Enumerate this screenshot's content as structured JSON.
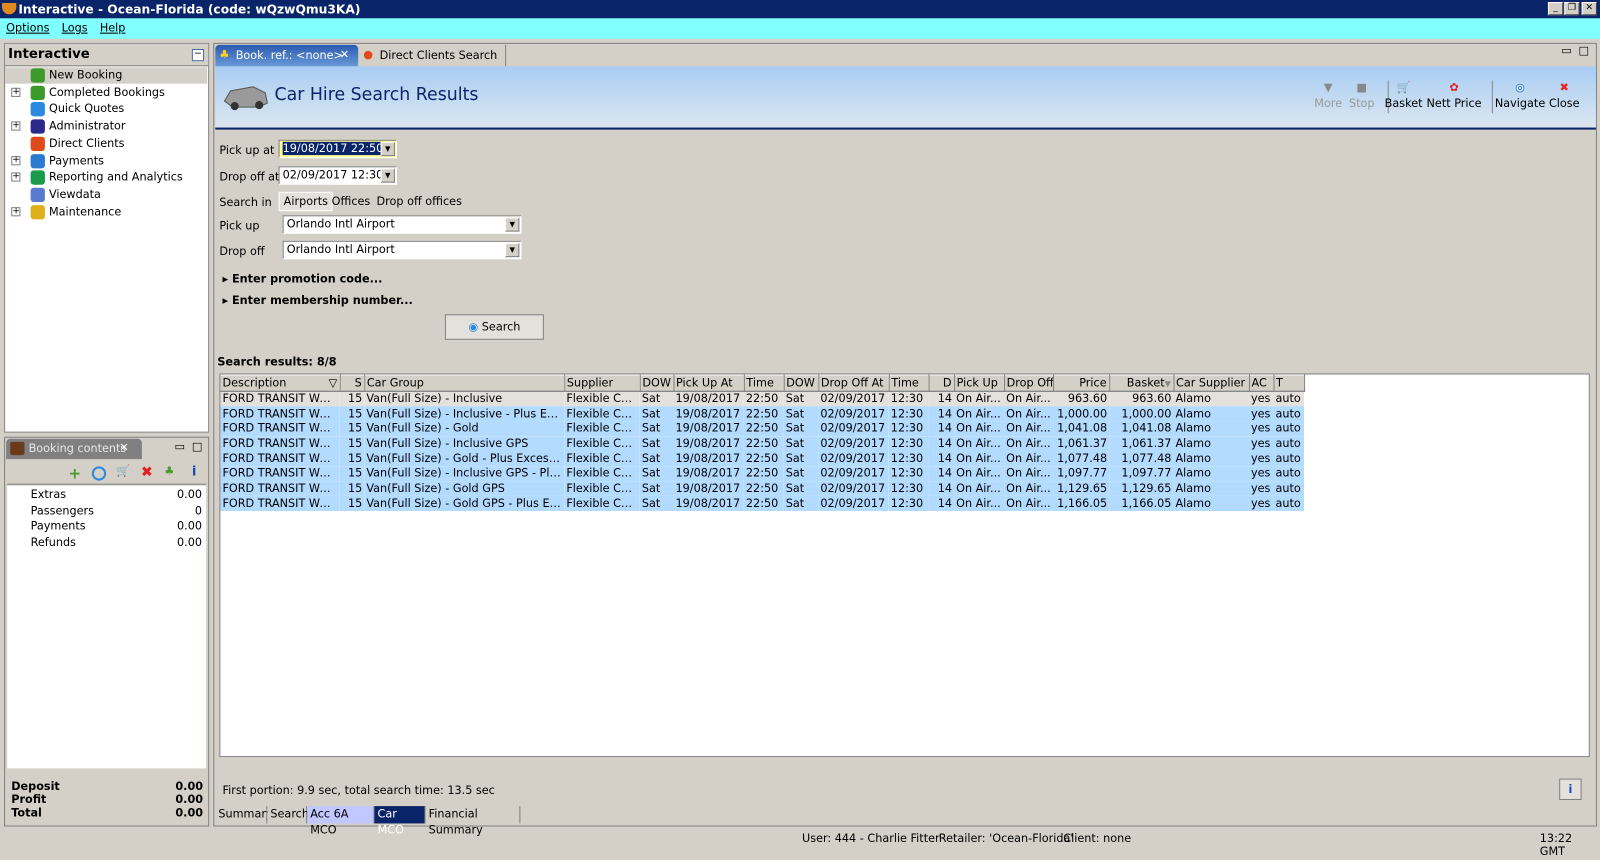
{
  "window": {
    "title": "Interactive - Ocean-Florida (code: wQzwQmu3KA)"
  },
  "menu": [
    "Options",
    "Logs",
    "Help"
  ],
  "sidebar": {
    "title": "Interactive",
    "items": [
      {
        "label": "New Booking",
        "expandable": false,
        "icon": "palm-tree-icon",
        "color": "#3a9a2a"
      },
      {
        "label": "Completed Bookings",
        "expandable": true,
        "icon": "palm-money-icon",
        "color": "#3a9a2a"
      },
      {
        "label": "Quick Quotes",
        "expandable": false,
        "icon": "clock-icon",
        "color": "#2a8ae0"
      },
      {
        "label": "Administrator",
        "expandable": true,
        "icon": "running-man-icon",
        "color": "#2a2a8a"
      },
      {
        "label": "Direct Clients",
        "expandable": false,
        "icon": "person-icon",
        "color": "#e04a1a"
      },
      {
        "label": "Payments",
        "expandable": true,
        "icon": "card-dollar-icon",
        "color": "#2a7ad0"
      },
      {
        "label": "Reporting and Analytics",
        "expandable": true,
        "icon": "report-icon",
        "color": "#1a9a4a"
      },
      {
        "label": "Viewdata",
        "expandable": false,
        "icon": "globe-icon",
        "color": "#5a7ad0"
      },
      {
        "label": "Maintenance",
        "expandable": true,
        "icon": "toolbox-icon",
        "color": "#e0b01a"
      }
    ]
  },
  "booking_contents": {
    "title": "Booking contents",
    "rows": [
      {
        "label": "Extras",
        "value": "0.00"
      },
      {
        "label": "Passengers",
        "value": "0"
      },
      {
        "label": "Payments",
        "value": "0.00"
      },
      {
        "label": "Refunds",
        "value": "0.00"
      }
    ],
    "totals": [
      {
        "label": "Deposit",
        "value": "0.00"
      },
      {
        "label": "Profit",
        "value": "0.00"
      },
      {
        "label": "Total",
        "value": "0.00"
      }
    ]
  },
  "tabs": [
    {
      "label": "Book. ref.: <none>",
      "active": true
    },
    {
      "label": "Direct Clients Search",
      "active": false
    }
  ],
  "header": {
    "title": "Car Hire Search Results"
  },
  "toolbar": [
    {
      "label": "More",
      "disabled": true,
      "icon": "more-arrow-icon"
    },
    {
      "label": "Stop",
      "disabled": true,
      "icon": "stop-icon"
    },
    {
      "label": "Basket",
      "disabled": false,
      "icon": "basket-icon"
    },
    {
      "label": "Nett Price",
      "disabled": false,
      "icon": "nett-price-icon"
    },
    {
      "label": "Navigate",
      "disabled": false,
      "icon": "compass-icon"
    },
    {
      "label": "Close",
      "disabled": false,
      "icon": "close-icon"
    }
  ],
  "form": {
    "pickup_at_label": "Pick up at",
    "pickup_at": "19/08/2017 22:50",
    "dropoff_at_label": "Drop off at",
    "dropoff_at": "02/09/2017 12:30",
    "search_in_label": "Search in",
    "search_in_options": [
      "Airports",
      "Offices",
      "Drop off offices"
    ],
    "search_in_selected": "Airports",
    "pickup_label": "Pick up",
    "pickup": "Orlando Intl Airport",
    "dropoff_label": "Drop off",
    "dropoff": "Orlando Intl Airport",
    "promo": "Enter promotion code...",
    "membership": "Enter membership number...",
    "search_button": "Search"
  },
  "results": {
    "summary": "Search results: 8/8",
    "columns": [
      "Description",
      "S",
      "Car Group",
      "Supplier",
      "DOW",
      "Pick Up At",
      "Time",
      "DOW",
      "Drop Off At",
      "Time",
      "D",
      "Pick Up",
      "Drop Off",
      "Price",
      "Basket",
      "Car Supplier",
      "AC",
      "T"
    ],
    "rows": [
      [
        "FORD TRANSIT WAG...",
        "15",
        "Van(Full Size) - Inclusive",
        "Flexible Car...",
        "Sat",
        "19/08/2017",
        "22:50",
        "Sat",
        "02/09/2017",
        "12:30",
        "14",
        "On Air...",
        "On Air...",
        "963.60",
        "963.60",
        "Alamo",
        "yes",
        "auto"
      ],
      [
        "FORD TRANSIT WAG...",
        "15",
        "Van(Full Size) - Inclusive - Plus Excess...",
        "Flexible Car...",
        "Sat",
        "19/08/2017",
        "22:50",
        "Sat",
        "02/09/2017",
        "12:30",
        "14",
        "On Air...",
        "On Air...",
        "1,000.00",
        "1,000.00",
        "Alamo",
        "yes",
        "auto"
      ],
      [
        "FORD TRANSIT WAG...",
        "15",
        "Van(Full Size) - Gold",
        "Flexible Car...",
        "Sat",
        "19/08/2017",
        "22:50",
        "Sat",
        "02/09/2017",
        "12:30",
        "14",
        "On Air...",
        "On Air...",
        "1,041.08",
        "1,041.08",
        "Alamo",
        "yes",
        "auto"
      ],
      [
        "FORD TRANSIT WAG...",
        "15",
        "Van(Full Size) - Inclusive GPS",
        "Flexible Car...",
        "Sat",
        "19/08/2017",
        "22:50",
        "Sat",
        "02/09/2017",
        "12:30",
        "14",
        "On Air...",
        "On Air...",
        "1,061.37",
        "1,061.37",
        "Alamo",
        "yes",
        "auto"
      ],
      [
        "FORD TRANSIT WAG...",
        "15",
        "Van(Full Size) - Gold - Plus Excess Ref...",
        "Flexible Car...",
        "Sat",
        "19/08/2017",
        "22:50",
        "Sat",
        "02/09/2017",
        "12:30",
        "14",
        "On Air...",
        "On Air...",
        "1,077.48",
        "1,077.48",
        "Alamo",
        "yes",
        "auto"
      ],
      [
        "FORD TRANSIT WAG...",
        "15",
        "Van(Full Size) - Inclusive GPS - Plus Ex...",
        "Flexible Car...",
        "Sat",
        "19/08/2017",
        "22:50",
        "Sat",
        "02/09/2017",
        "12:30",
        "14",
        "On Air...",
        "On Air...",
        "1,097.77",
        "1,097.77",
        "Alamo",
        "yes",
        "auto"
      ],
      [
        "FORD TRANSIT WAG...",
        "15",
        "Van(Full Size) - Gold GPS",
        "Flexible Car...",
        "Sat",
        "19/08/2017",
        "22:50",
        "Sat",
        "02/09/2017",
        "12:30",
        "14",
        "On Air...",
        "On Air...",
        "1,129.65",
        "1,129.65",
        "Alamo",
        "yes",
        "auto"
      ],
      [
        "FORD TRANSIT WAG...",
        "15",
        "Van(Full Size) - Gold GPS - Plus Excess...",
        "Flexible Car...",
        "Sat",
        "19/08/2017",
        "22:50",
        "Sat",
        "02/09/2017",
        "12:30",
        "14",
        "On Air...",
        "On Air...",
        "1,166.05",
        "1,166.05",
        "Alamo",
        "yes",
        "auto"
      ]
    ],
    "timing": "First portion: 9.9 sec, total search time: 13.5 sec"
  },
  "bottom_tabs": [
    {
      "label": "Summary",
      "state": "normal"
    },
    {
      "label": "Search",
      "state": "normal"
    },
    {
      "label": "Acc 6A MCO",
      "state": "light"
    },
    {
      "label": "Car MCO",
      "state": "active"
    },
    {
      "label": "Financial Summary",
      "state": "normal"
    }
  ],
  "status": {
    "user": "User: 444 - Charlie Fitter",
    "retailer": "Retailer: 'Ocean-Florida'",
    "client": "Client: none",
    "time": "13:22 GMT"
  },
  "colors": {
    "title_bar": "#0a246a",
    "menu_bar": "#80ffff",
    "header_title": "#0a246a",
    "row_selected": "#b3dbff"
  }
}
